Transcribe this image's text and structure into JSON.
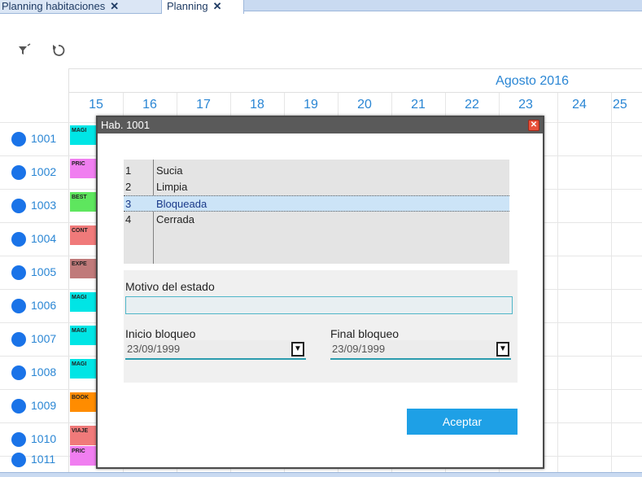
{
  "tabs": [
    {
      "label": "Planning habitaciones",
      "close": "✕"
    },
    {
      "label": "Planning",
      "close": "✕"
    }
  ],
  "toolbar": {
    "filter_icon": "filter-icon",
    "refresh_icon": "refresh-icon"
  },
  "calendar": {
    "month": "Agosto 2016",
    "days": [
      "15",
      "16",
      "17",
      "18",
      "19",
      "20",
      "21",
      "22",
      "23",
      "24",
      "25"
    ]
  },
  "rooms": [
    {
      "number": "1001",
      "booking": "MAGI",
      "color": "#00e5e5"
    },
    {
      "number": "1002",
      "booking": "PRIC",
      "color": "#f07ef0"
    },
    {
      "number": "1003",
      "booking": "BEST",
      "color": "#5ee65e"
    },
    {
      "number": "1004",
      "booking": "CONT",
      "color": "#f07a7a"
    },
    {
      "number": "1005",
      "booking": "EXPE",
      "color": "#c07a7a"
    },
    {
      "number": "1006",
      "booking": "MAGI",
      "color": "#00e5e5"
    },
    {
      "number": "1007",
      "booking": "MAGI",
      "color": "#00e5e5"
    },
    {
      "number": "1008",
      "booking": "MAGI",
      "color": "#00e5e5"
    },
    {
      "number": "1009",
      "booking": "BOOK",
      "color": "#ff8c00"
    },
    {
      "number": "1010",
      "booking": "VIAJE",
      "color": "#f07a7a"
    },
    {
      "number": "1011",
      "booking": "PRIC",
      "color": "#f07ef0"
    }
  ],
  "dialog": {
    "title": "Hab. 1001",
    "close": "✕",
    "statuses": [
      {
        "id": "1",
        "label": "Sucia"
      },
      {
        "id": "2",
        "label": "Limpia"
      },
      {
        "id": "3",
        "label": "Bloqueada"
      },
      {
        "id": "4",
        "label": "Cerrada"
      }
    ],
    "selected_status": "3",
    "motivo_label": "Motivo del estado",
    "motivo_value": "",
    "inicio_label": "Inicio bloqueo",
    "inicio_value": "23/09/1999",
    "final_label": "Final bloqueo",
    "final_value": "23/09/1999",
    "dropdown_glyph": "▼",
    "accept_label": "Aceptar"
  },
  "colors": {
    "accent": "#2a86d4",
    "accept_button": "#1ea0e6",
    "room_dot": "#1a73e8"
  }
}
